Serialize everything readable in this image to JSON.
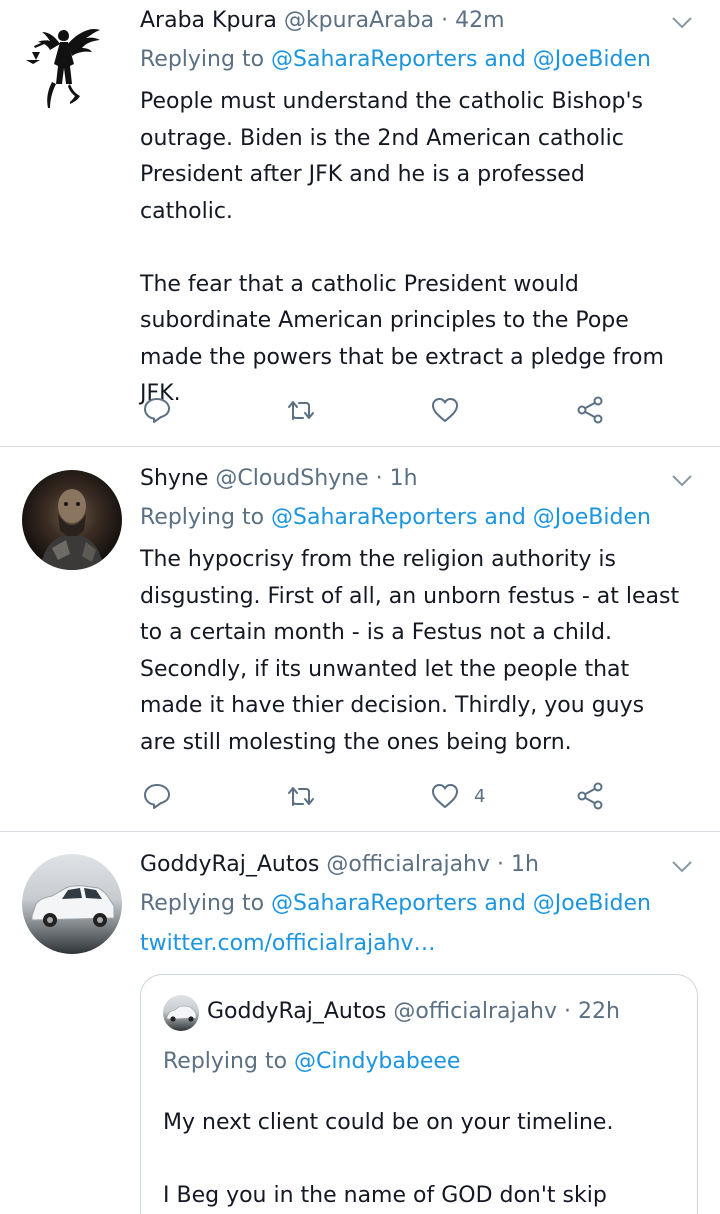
{
  "tweets": [
    {
      "name": "Araba Kpura",
      "handle": "@kpuraAraba",
      "time": "· 42m",
      "replying_prefix": "Replying to",
      "replying_to_1": "@SaharaReporters",
      "replying_and": "and",
      "replying_to_2": "@JoeBiden",
      "paragraphs": [
        "People must understand the catholic Bishop's outrage. Biden is the 2nd American catholic President after JFK and he is a professed catholic.",
        "The fear that a catholic President would subordinate American principles to the Pope made the powers that be extract a pledge from JFK."
      ],
      "like_count": ""
    },
    {
      "name": "Shyne",
      "handle": "@CloudShyne",
      "time": "· 1h",
      "replying_prefix": "Replying to",
      "replying_to_1": "@SaharaReporters",
      "replying_and": "and",
      "replying_to_2": "@JoeBiden",
      "paragraphs": [
        "The hypocrisy from the religion authority is disgusting. First of all, an unborn festus - at least to a certain month - is a Festus not a child. Secondly, if its unwanted let the people that made it have thier decision. Thirdly, you guys are still molesting the ones being born."
      ],
      "like_count": "4"
    },
    {
      "name": "GoddyRaj_Autos",
      "handle": "@officialrajahv",
      "time": "· 1h",
      "replying_prefix": "Replying to",
      "replying_to_1": "@SaharaReporters",
      "replying_and": "and",
      "replying_to_2": "@JoeBiden",
      "link": "twitter.com/officialrajahv…",
      "quote": {
        "name": "GoddyRaj_Autos",
        "handle": "@officialrajahv",
        "time": "· 22h",
        "replying_prefix": "Replying to",
        "replying_to": "@Cindybabeee",
        "paragraphs": [
          "My next client could be on your timeline.",
          "I Beg you in the name of GOD don't skip"
        ]
      }
    }
  ],
  "icons": {
    "reply": "reply-icon",
    "retweet": "retweet-icon",
    "like": "heart-icon",
    "share": "share-icon",
    "more": "chevron-down-icon"
  },
  "colors": {
    "accent": "#1b95e0",
    "secondary": "#5b7083",
    "text": "#141823",
    "divider": "#d9dde1"
  }
}
